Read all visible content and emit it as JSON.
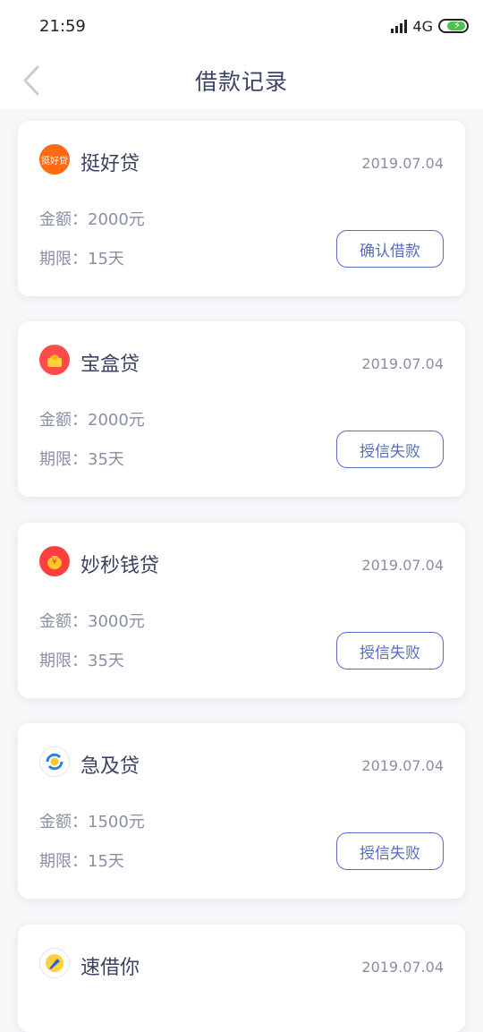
{
  "status": {
    "time": "21:59",
    "network": "4G"
  },
  "nav": {
    "title": "借款记录"
  },
  "records": [
    {
      "name": "挺好贷",
      "logo_text": "挺好贷",
      "logo_color": "#ff6a13",
      "date": "2019.07.04",
      "amount": "金额：2000元",
      "term": "期限：15天",
      "action": "确认借款"
    },
    {
      "name": "宝盒贷",
      "logo_text": "",
      "logo_color": "#ff4b4b",
      "date": "2019.07.04",
      "amount": "金额：2000元",
      "term": "期限：35天",
      "action": "授信失败"
    },
    {
      "name": "妙秒钱贷",
      "logo_text": "¥",
      "logo_color": "#ff3f3f",
      "date": "2019.07.04",
      "amount": "金额：3000元",
      "term": "期限：35天",
      "action": "授信失败"
    },
    {
      "name": "急及贷",
      "logo_text": "",
      "logo_color": "#ffffff",
      "date": "2019.07.04",
      "amount": "金额：1500元",
      "term": "期限：15天",
      "action": "授信失败"
    },
    {
      "name": "速借你",
      "logo_text": "",
      "logo_color": "#ffffff",
      "date": "2019.07.04",
      "amount": "",
      "term": "",
      "action": ""
    }
  ]
}
